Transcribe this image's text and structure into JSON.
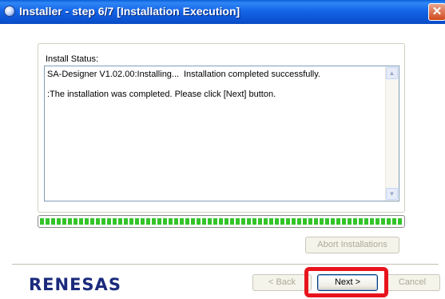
{
  "window": {
    "title": "Installer - step 6/7 [Installation Execution]",
    "close_glyph": "✕"
  },
  "install_status": {
    "label": "Install Status:",
    "lines": [
      {
        "left": "SA-Designer V1.02.00:Installing...",
        "right": "Installation completed successfully."
      },
      {
        "left": ":The installation was completed. Please click [Next] button.",
        "right": ""
      }
    ]
  },
  "progress": {
    "value": 1.0,
    "color": "#34c42a"
  },
  "buttons": {
    "abort": "Abort Installations",
    "back": "< Back",
    "next": "Next >",
    "cancel": "Cancel"
  },
  "brand": {
    "logo_text": "RENESAS",
    "color": "#1a2a7c"
  },
  "highlight_color": "#e8141c",
  "icons": {
    "scroll_up": "scroll-up-arrow",
    "scroll_down": "scroll-down-arrow"
  }
}
